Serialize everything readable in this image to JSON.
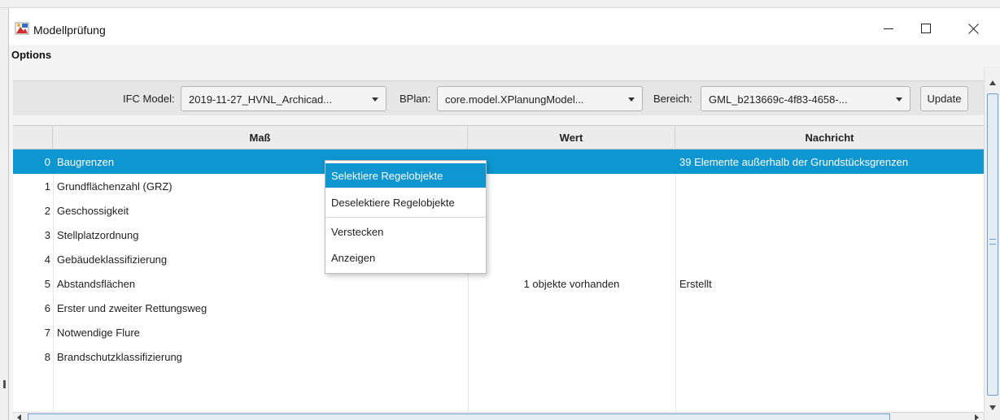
{
  "window": {
    "title": "Modellprüfung",
    "controls": {
      "minimize_icon": "minimize-icon",
      "maximize_icon": "maximize-icon",
      "close_icon": "close-icon"
    }
  },
  "menubar": {
    "items": [
      "Options"
    ]
  },
  "toolbar": {
    "ifc_label": "IFC Model:",
    "ifc_value": "2019-11-27_HVNL_Archicad...",
    "bplan_label": "BPlan:",
    "bplan_value": "core.model.XPlanungModel...",
    "bereich_label": "Bereich:",
    "bereich_value": "GML_b213669c-4f83-4658-...",
    "update_label": "Update"
  },
  "table": {
    "columns": [
      "",
      "Maß",
      "Wert",
      "Nachricht"
    ],
    "rows": [
      {
        "index": "0",
        "mass": "Baugrenzen",
        "wert": "",
        "nachricht": "39 Elemente außerhalb der Grundstücksgrenzen",
        "selected": true
      },
      {
        "index": "1",
        "mass": "Grundflächenzahl (GRZ)",
        "wert": "",
        "nachricht": ""
      },
      {
        "index": "2",
        "mass": "Geschossigkeit",
        "wert": "",
        "nachricht": ""
      },
      {
        "index": "3",
        "mass": "Stellplatzordnung",
        "wert": "",
        "nachricht": ""
      },
      {
        "index": "4",
        "mass": "Gebäudeklassifizierung",
        "wert": "",
        "nachricht": ""
      },
      {
        "index": "5",
        "mass": "Abstandsflächen",
        "wert": "1 objekte vorhanden",
        "nachricht": "Erstellt"
      },
      {
        "index": "6",
        "mass": "Erster und zweiter Rettungsweg",
        "wert": "",
        "nachricht": ""
      },
      {
        "index": "7",
        "mass": "Notwendige Flure",
        "wert": "",
        "nachricht": ""
      },
      {
        "index": "8",
        "mass": "Brandschutzklassifizierung",
        "wert": "",
        "nachricht": ""
      }
    ]
  },
  "context_menu": {
    "items": [
      "Selektiere Regelobjekte",
      "Deselektiere Regelobjekte",
      "Verstecken",
      "Anzeigen"
    ],
    "highlighted": "Selektiere Regelobjekte"
  },
  "colors": {
    "selection": "#0d96d0",
    "scroll_thumb_border": "#6aa0d8"
  }
}
